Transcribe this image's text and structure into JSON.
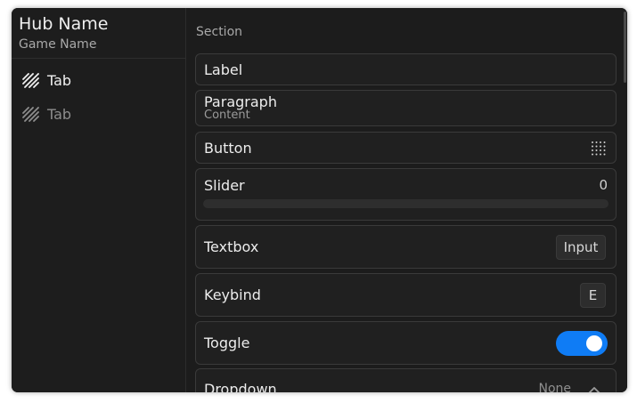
{
  "sidebar": {
    "hub_name": "Hub Name",
    "game_name": "Game Name",
    "tabs": [
      {
        "label": "Tab",
        "icon": "hatch-icon",
        "active": true
      },
      {
        "label": "Tab",
        "icon": "hatch-icon",
        "active": false
      }
    ]
  },
  "main": {
    "section_title": "Section",
    "label": {
      "text": "Label"
    },
    "paragraph": {
      "title": "Paragraph",
      "content": "Content"
    },
    "button": {
      "label": "Button",
      "icon": "grid-dots-icon"
    },
    "slider": {
      "label": "Slider",
      "value": "0",
      "fraction": 0
    },
    "textbox": {
      "label": "Textbox",
      "placeholder": "Input"
    },
    "keybind": {
      "label": "Keybind",
      "key": "E"
    },
    "toggle": {
      "label": "Toggle",
      "state": true,
      "color": "#0f7cf5"
    },
    "dropdown": {
      "label": "Dropdown",
      "value": "None",
      "icon": "chevron-up-icon"
    }
  }
}
